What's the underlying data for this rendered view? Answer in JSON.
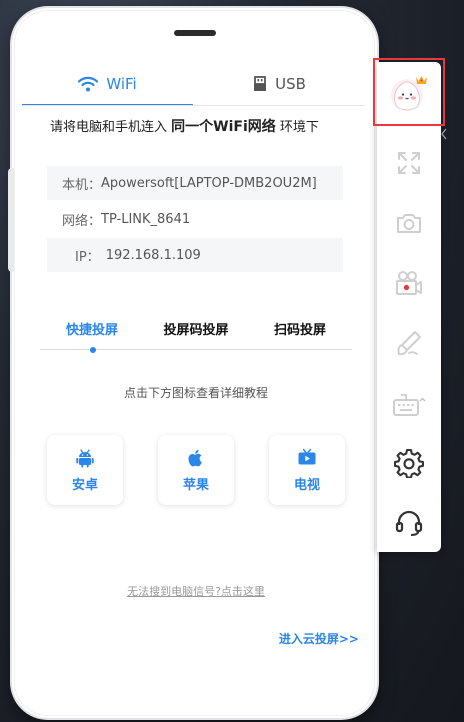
{
  "tabs": {
    "wifi_label": "WiFi",
    "usb_label": "USB"
  },
  "connect": {
    "prefix": "请将电脑和手机连入",
    "strong": "同一个WiFi网络",
    "suffix": "环境下"
  },
  "info": {
    "host_label": "本机：",
    "host_value": "Apowersoft[LAPTOP-DMB2OU2M]",
    "network_label": "网络：",
    "network_value": "TP-LINK_8641",
    "ip_label": "IP：",
    "ip_value": "192.168.1.109"
  },
  "modes": [
    "快捷投屏",
    "投屏码投屏",
    "扫码投屏"
  ],
  "hint": "点击下方图标查看详细教程",
  "os_buttons": {
    "android": "安卓",
    "apple": "苹果",
    "tv": "电视"
  },
  "cant_find": "无法搜到电脑信号?点击这里",
  "cloud_link": "进入云投屏>>",
  "colors": {
    "accent": "#2a86e8",
    "highlight_border": "#e8383f",
    "icon_gray": "#cfcfcf",
    "icon_dark": "#333333"
  },
  "sidebar_icons": [
    "avatar-icon",
    "fullscreen-icon",
    "camera-icon",
    "video-record-icon",
    "brush-icon",
    "keyboard-icon",
    "settings-icon",
    "headset-icon"
  ]
}
